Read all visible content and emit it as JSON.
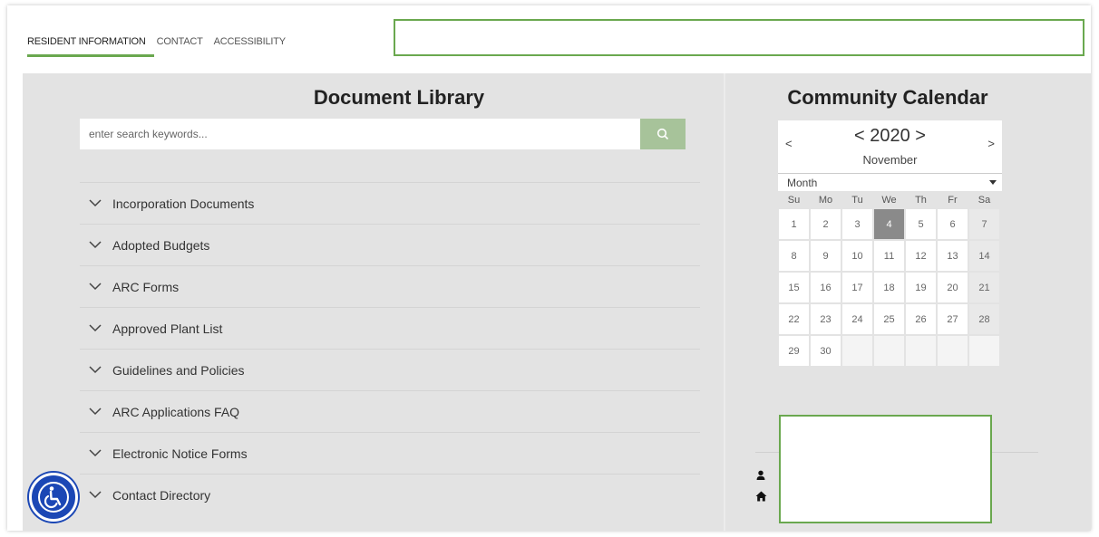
{
  "nav": {
    "items": [
      {
        "label": "RESIDENT INFORMATION"
      },
      {
        "label": "CONTACT"
      },
      {
        "label": "ACCESSIBILITY"
      }
    ]
  },
  "document_library": {
    "title": "Document Library",
    "search_placeholder": "enter search keywords...",
    "items": [
      {
        "label": "Incorporation Documents"
      },
      {
        "label": "Adopted Budgets"
      },
      {
        "label": "ARC Forms"
      },
      {
        "label": "Approved Plant List"
      },
      {
        "label": "Guidelines and Policies"
      },
      {
        "label": "ARC Applications FAQ"
      },
      {
        "label": "Electronic Notice Forms"
      },
      {
        "label": "Contact Directory"
      }
    ]
  },
  "calendar": {
    "title": "Community Calendar",
    "year_label": "< 2020 >",
    "month": "November",
    "prev": "<",
    "next": ">",
    "view_select": "Month",
    "weekdays": [
      "Su",
      "Mo",
      "Tu",
      "We",
      "Th",
      "Fr",
      "Sa"
    ],
    "weeks": [
      [
        "1",
        "2",
        "3",
        "4",
        "5",
        "6",
        "7"
      ],
      [
        "8",
        "9",
        "10",
        "11",
        "12",
        "13",
        "14"
      ],
      [
        "15",
        "16",
        "17",
        "18",
        "19",
        "20",
        "21"
      ],
      [
        "22",
        "23",
        "24",
        "25",
        "26",
        "27",
        "28"
      ],
      [
        "29",
        "30",
        "",
        "",
        "",
        "",
        ""
      ]
    ],
    "today": "4"
  },
  "colors": {
    "accent": "#6aa84f",
    "search_button": "#a7c39a",
    "content_bg": "#e3e3e3",
    "today_bg": "#8a8a8a",
    "accessibility_button": "#1b47b5"
  },
  "icons": {
    "search": "search-icon",
    "chevron": "chevron-down-icon",
    "person": "person-icon",
    "home": "home-icon",
    "accessibility": "accessibility-icon"
  }
}
